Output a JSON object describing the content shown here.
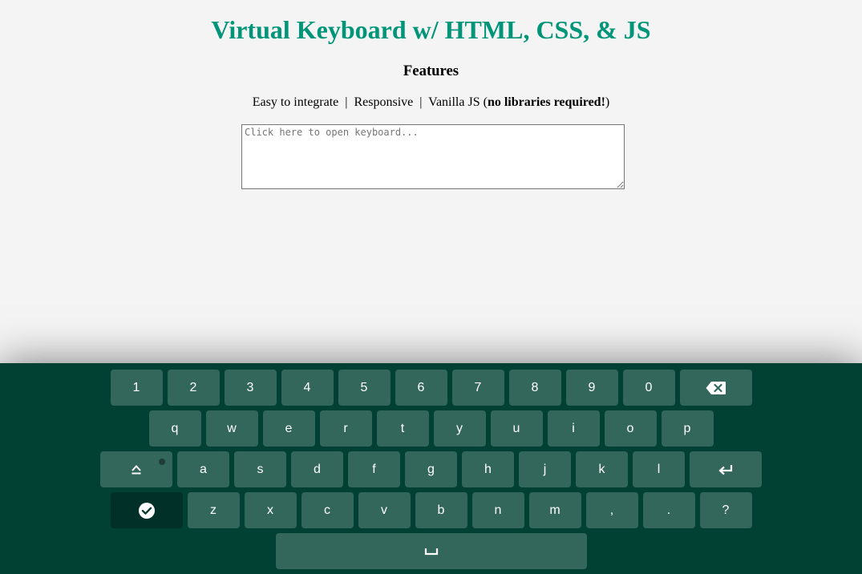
{
  "header": {
    "title": "Virtual Keyboard w/ HTML, CSS, & JS",
    "features_heading": "Features",
    "features": {
      "part1": "Easy to integrate  |  Responsive  |  Vanilla JS (",
      "bold": "no libraries required!",
      "part2": ")"
    }
  },
  "input": {
    "placeholder": "Click here to open keyboard...",
    "value": ""
  },
  "keyboard": {
    "row1": [
      "1",
      "2",
      "3",
      "4",
      "5",
      "6",
      "7",
      "8",
      "9",
      "0"
    ],
    "row2": [
      "q",
      "w",
      "e",
      "r",
      "t",
      "y",
      "u",
      "i",
      "o",
      "p"
    ],
    "row3": [
      "a",
      "s",
      "d",
      "f",
      "g",
      "h",
      "j",
      "k",
      "l"
    ],
    "row4": [
      "z",
      "x",
      "c",
      "v",
      "b",
      "n",
      "m",
      ",",
      ".",
      "?"
    ],
    "special_icons": {
      "backspace": "backspace-icon",
      "caps": "caps-lock-icon",
      "enter": "enter-icon",
      "done": "check-circle-icon",
      "space": "space-bar-icon"
    }
  },
  "colors": {
    "title": "#009578",
    "keyboard_background": "#004134",
    "key_background": "rgba(255,255,255,0.2)",
    "key_text": "#ffffff"
  }
}
